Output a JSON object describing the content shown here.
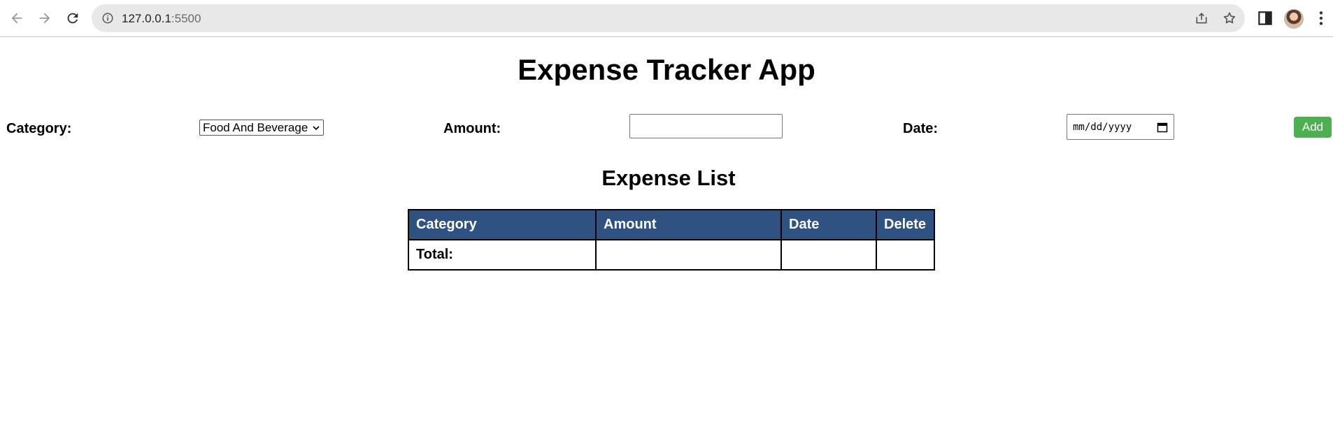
{
  "browser": {
    "url_host": "127.0.0.1",
    "url_port": ":5500",
    "icons": [
      "back-icon",
      "forward-icon",
      "reload-icon",
      "info-icon",
      "share-icon",
      "star-icon",
      "side-panel-icon",
      "avatar",
      "menu-icon"
    ]
  },
  "app": {
    "title": "Expense Tracker App",
    "form": {
      "category_label": "Category:",
      "category_selected": "Food And Beverage",
      "amount_label": "Amount:",
      "amount_value": "",
      "date_label": "Date:",
      "date_placeholder": "mm/dd/yyyy",
      "add_label": "Add"
    },
    "list_title": "Expense List",
    "table": {
      "headers": [
        "Category",
        "Amount",
        "Date",
        "Delete"
      ],
      "total_label": "Total:",
      "total_amount": "",
      "total_date": "",
      "total_delete": ""
    }
  },
  "colors": {
    "add_button": "#4caf50",
    "table_header": "#2f5283"
  }
}
